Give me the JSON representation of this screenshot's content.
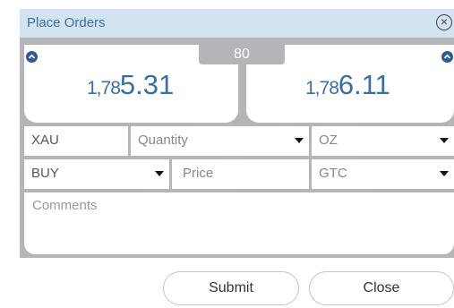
{
  "window": {
    "title": "Place Orders"
  },
  "prices": {
    "bid": {
      "prefix": "1,78",
      "main": "5.31"
    },
    "ask": {
      "prefix": "1,78",
      "main": "6.11"
    },
    "spread": "80"
  },
  "order": {
    "symbol": "XAU",
    "quantity_placeholder": "Quantity",
    "unit": "OZ",
    "side": "BUY",
    "price_placeholder": "Price",
    "tif": "GTC",
    "comments_placeholder": "Comments"
  },
  "buttons": {
    "submit": "Submit",
    "close": "Close"
  }
}
